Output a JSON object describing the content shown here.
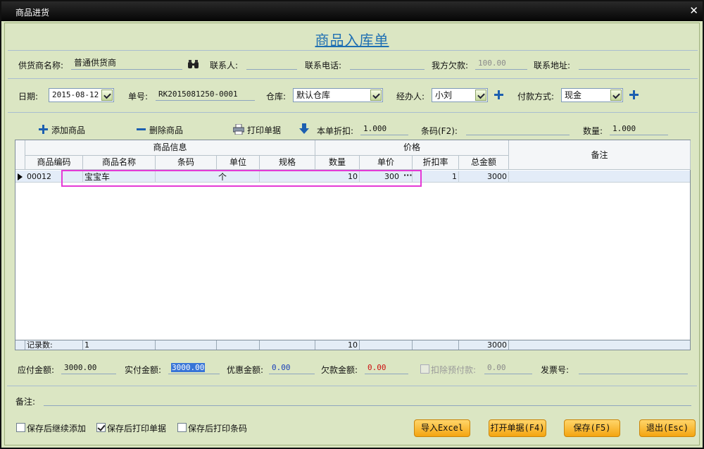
{
  "window": {
    "title": "商品进货",
    "close_glyph": "✕"
  },
  "form_title": "商品入库单",
  "supplier": {
    "label": "供货商名称:",
    "value": "普通供货商",
    "search_icon": "binoculars-icon"
  },
  "contact": {
    "label": "联系人:",
    "value": ""
  },
  "phone": {
    "label": "联系电话:",
    "value": ""
  },
  "owed": {
    "label": "我方欠款:",
    "value": "100.00"
  },
  "address": {
    "label": "联系地址:",
    "value": ""
  },
  "date": {
    "label": "日期:",
    "value": "2015-08-12"
  },
  "order_no": {
    "label": "单号:",
    "value": "RK2015081250-0001"
  },
  "warehouse": {
    "label": "仓库:",
    "value": "默认仓库"
  },
  "handler": {
    "label": "经办人:",
    "value": "小刘"
  },
  "payment": {
    "label": "付款方式:",
    "value": "现金"
  },
  "toolbar": {
    "add": "添加商品",
    "delete": "删除商品",
    "print": "打印单据",
    "discount_label": "本单折扣:",
    "discount_value": "1.000",
    "barcode_label": "条码(F2):",
    "barcode_value": "",
    "qty_label": "数量:",
    "qty_value": "1.000"
  },
  "grid": {
    "group_product": "商品信息",
    "group_price": "价格",
    "remark_header": "备注",
    "columns": [
      "商品编码",
      "商品名称",
      "条码",
      "单位",
      "规格",
      "数量",
      "单价",
      "折扣率",
      "总金额"
    ],
    "rows": [
      {
        "code": "00012",
        "name": "宝宝车",
        "barcode": "",
        "unit": "个",
        "spec": "",
        "qty": "10",
        "price": "300",
        "discount": "1",
        "total": "3000",
        "remark": ""
      }
    ],
    "ellipsis": "···",
    "footer": {
      "label": "记录数:",
      "count": "1",
      "qty": "10",
      "total": "3000"
    }
  },
  "summary": {
    "payable_label": "应付金额:",
    "payable_value": "3000.00",
    "paid_label": "实付金额:",
    "paid_value": "3000.00",
    "discount_label": "优惠金额:",
    "discount_value": "0.00",
    "owed_label": "欠款金额:",
    "owed_value": "0.00",
    "prepay_label": "扣除预付款:",
    "prepay_value": "0.00",
    "invoice_label": "发票号:",
    "invoice_value": ""
  },
  "remark": {
    "label": "备注:",
    "value": ""
  },
  "options": {
    "continue_add": {
      "label": "保存后继续添加",
      "checked": false
    },
    "print_bill": {
      "label": "保存后打印单据",
      "checked": true
    },
    "print_barcode": {
      "label": "保存后打印条码",
      "checked": false
    }
  },
  "buttons": {
    "import_excel": "导入Excel",
    "open_bill": "打开单据(F4)",
    "save": "保存(F5)",
    "exit": "退出(Esc)"
  },
  "colors": {
    "title_blue": "#1e6fb3",
    "discount_blue": "#1a3fb8",
    "owed_red": "#cc1010",
    "highlight": "#e53ad6",
    "button_orange": "#f4a510"
  }
}
